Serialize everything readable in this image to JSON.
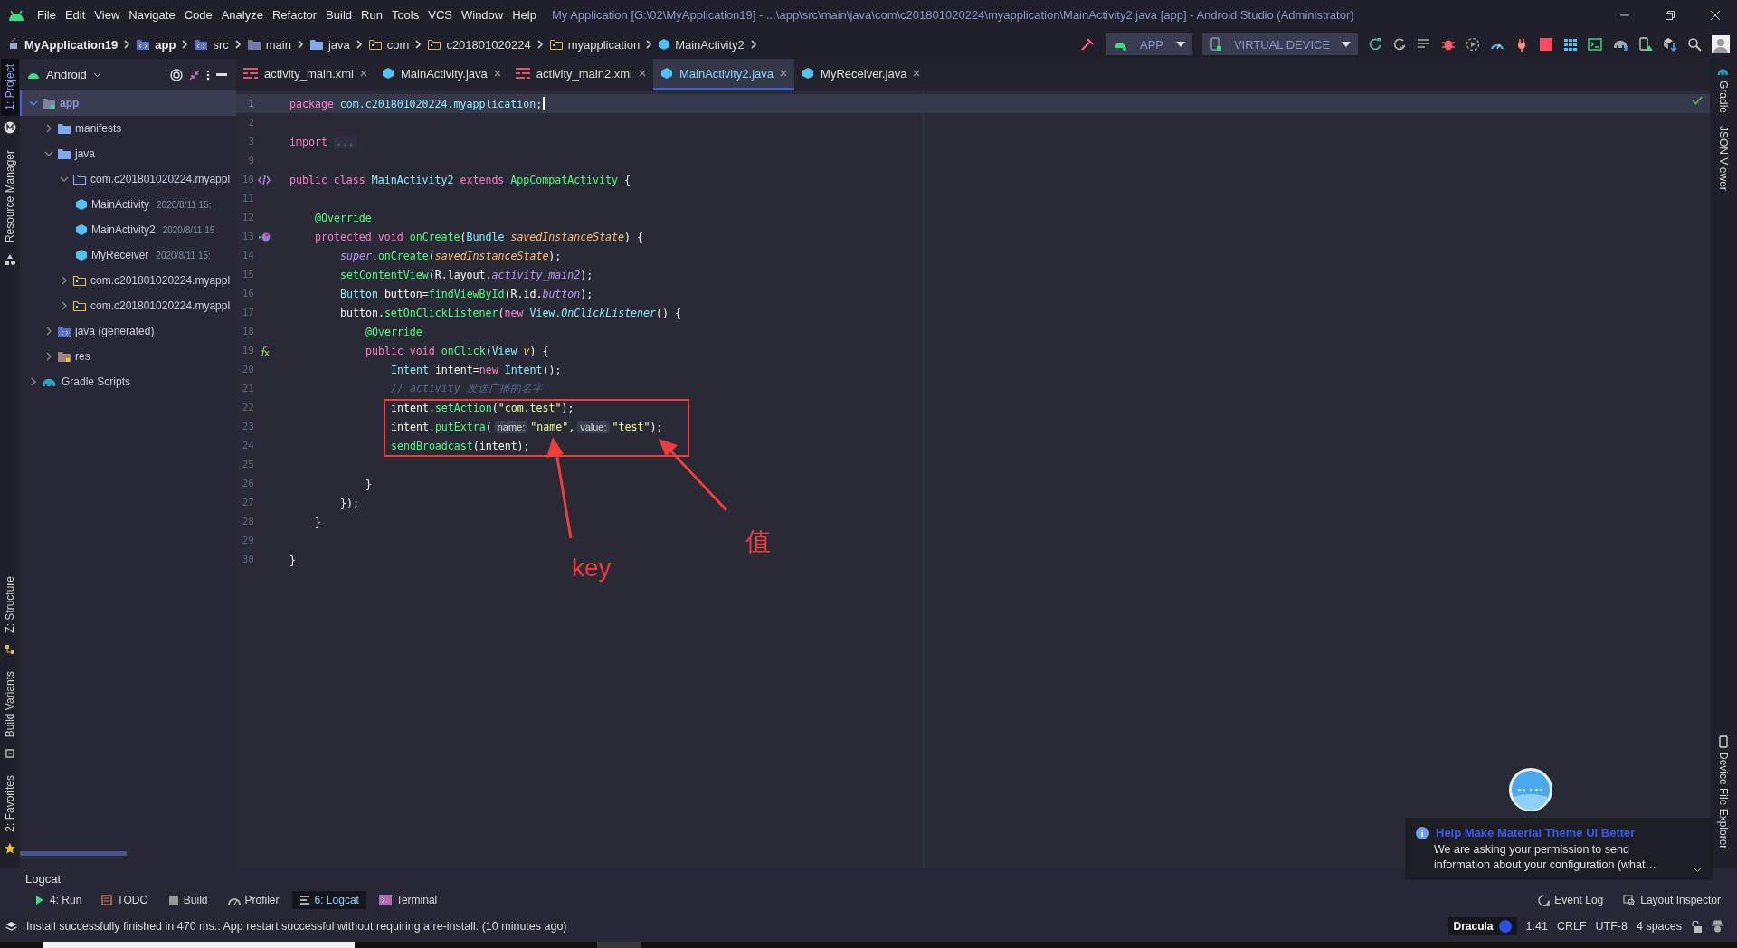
{
  "window": {
    "title": "My Application [G:\\02\\MyApplication19] - ...\\app\\src\\main\\java\\com\\c201801020224\\myapplication\\MainActivity2.java [app] - Android Studio (Administrator)"
  },
  "menu": [
    "File",
    "Edit",
    "View",
    "Navigate",
    "Code",
    "Analyze",
    "Refactor",
    "Build",
    "Run",
    "Tools",
    "VCS",
    "Window",
    "Help"
  ],
  "breadcrumb": [
    {
      "label": "MyApplication19",
      "kind": "project"
    },
    {
      "label": "app",
      "kind": "module"
    },
    {
      "label": "src",
      "kind": "source"
    },
    {
      "label": "main",
      "kind": "folder"
    },
    {
      "label": "java",
      "kind": "javafolder"
    },
    {
      "label": "com",
      "kind": "package"
    },
    {
      "label": "c201801020224",
      "kind": "package"
    },
    {
      "label": "myapplication",
      "kind": "package"
    },
    {
      "label": "MainActivity2",
      "kind": "class"
    }
  ],
  "toolbar": {
    "run_config": "APP",
    "device": "VIRTUAL DEVICE"
  },
  "left_tools_top": [
    {
      "label": "1: Project",
      "selected": true
    },
    {
      "label": "Resource Manager",
      "selected": false
    }
  ],
  "left_tools_bottom": [
    {
      "label": "Z: Structure",
      "selected": false
    },
    {
      "label": "Build Variants",
      "selected": false
    },
    {
      "label": "2: Favorites",
      "selected": false
    }
  ],
  "right_tools_top": [
    "Gradle",
    "JSON Viewer"
  ],
  "right_tools_bottom": [
    "Device File Explorer"
  ],
  "project_panel": {
    "view": "Android",
    "tree": [
      {
        "label": "app",
        "kind": "module",
        "expanded": true,
        "selected": true,
        "children": [
          {
            "label": "manifests",
            "kind": "folder",
            "expanded": false,
            "selected": false
          },
          {
            "label": "java",
            "kind": "folder",
            "expanded": true,
            "selected": false,
            "children": [
              {
                "label": "com.c201801020224.myappl",
                "kind": "package",
                "expanded": true,
                "selected": false,
                "children": [
                  {
                    "label": "MainActivity",
                    "kind": "class",
                    "date": "2020/8/11 15:",
                    "selected": false
                  },
                  {
                    "label": "MainActivity2",
                    "kind": "class",
                    "date": "2020/8/11 15",
                    "selected": false
                  },
                  {
                    "label": "MyReceiver",
                    "kind": "class",
                    "date": "2020/8/11 15:",
                    "selected": false
                  }
                ]
              },
              {
                "label": "com.c201801020224.myappl",
                "kind": "test_package",
                "expanded": false,
                "selected": false
              },
              {
                "label": "com.c201801020224.myappl",
                "kind": "test_package",
                "expanded": false,
                "selected": false
              }
            ]
          },
          {
            "label": "java (generated)",
            "kind": "generated",
            "expanded": false,
            "selected": false
          },
          {
            "label": "res",
            "kind": "res",
            "expanded": false,
            "selected": false
          }
        ]
      },
      {
        "label": "Gradle Scripts",
        "kind": "gradle",
        "expanded": false,
        "selected": false
      }
    ]
  },
  "tabs": [
    {
      "label": "activity_main.xml",
      "kind": "xml",
      "selected": false
    },
    {
      "label": "MainActivity.java",
      "kind": "class",
      "selected": false
    },
    {
      "label": "activity_main2.xml",
      "kind": "xml",
      "selected": false
    },
    {
      "label": "MainActivity2.java",
      "kind": "class",
      "selected": true
    },
    {
      "label": "MyReceiver.java",
      "kind": "class",
      "selected": false
    }
  ],
  "editor": {
    "lines": [
      {
        "number": "1",
        "current": true,
        "tokens": [
          {
            "kind": "keyword",
            "text": "package "
          },
          {
            "kind": "type",
            "text": "com.c201801020224.myapplication"
          },
          {
            "kind": "plain",
            "text": ";"
          }
        ]
      },
      {
        "number": "2",
        "current": false
      },
      {
        "number": "3",
        "current": false,
        "tokens": [
          {
            "kind": "keyword",
            "text": "import "
          },
          {
            "kind": "fold",
            "text": "..."
          }
        ]
      },
      {
        "number": "9",
        "current": false
      },
      {
        "number": "10",
        "current": false,
        "kind": "class",
        "tokens": [
          {
            "kind": "keyword",
            "text": "public class "
          },
          {
            "kind": "type",
            "text": "MainActivity2 "
          },
          {
            "kind": "keyword",
            "text": "extends "
          },
          {
            "kind": "function",
            "text": "AppCompatActivity "
          },
          {
            "kind": "plain",
            "text": "{"
          }
        ]
      },
      {
        "number": "11",
        "current": false
      },
      {
        "number": "12",
        "current": false,
        "tokens": [
          {
            "kind": "annotation",
            "text": "    @Override"
          }
        ]
      },
      {
        "number": "13",
        "current": false,
        "kind": "override",
        "tokens": [
          {
            "kind": "keyword",
            "text": "    protected void "
          },
          {
            "kind": "function",
            "text": "onCreate"
          },
          {
            "kind": "plain",
            "text": "("
          },
          {
            "kind": "type",
            "text": "Bundle "
          },
          {
            "kind": "param",
            "text": "savedInstanceState"
          },
          {
            "kind": "plain",
            "text": ") {"
          }
        ]
      },
      {
        "number": "14",
        "current": false,
        "tokens": [
          {
            "kind": "field",
            "text": "        super"
          },
          {
            "kind": "plain",
            "text": "."
          },
          {
            "kind": "function",
            "text": "onCreate"
          },
          {
            "kind": "plain",
            "text": "("
          },
          {
            "kind": "param",
            "text": "savedInstanceState"
          },
          {
            "kind": "plain",
            "text": ");"
          }
        ]
      },
      {
        "number": "15",
        "current": false,
        "tokens": [
          {
            "kind": "function",
            "text": "        setContentView"
          },
          {
            "kind": "plain",
            "text": "(R.layout."
          },
          {
            "kind": "field",
            "text": "activity_main2"
          },
          {
            "kind": "plain",
            "text": ");"
          }
        ]
      },
      {
        "number": "16",
        "current": false,
        "tokens": [
          {
            "kind": "type",
            "text": "        Button "
          },
          {
            "kind": "plain",
            "text": "button="
          },
          {
            "kind": "function",
            "text": "findViewById"
          },
          {
            "kind": "plain",
            "text": "(R.id."
          },
          {
            "kind": "field",
            "text": "button"
          },
          {
            "kind": "plain",
            "text": ");"
          }
        ]
      },
      {
        "number": "17",
        "current": false,
        "tokens": [
          {
            "kind": "plain",
            "text": "        button."
          },
          {
            "kind": "function",
            "text": "setOnClickListener"
          },
          {
            "kind": "plain",
            "text": "("
          },
          {
            "kind": "keyword",
            "text": "new "
          },
          {
            "kind": "type",
            "text": "View."
          },
          {
            "kind": "type_italic",
            "text": "OnClickListener"
          },
          {
            "kind": "plain",
            "text": "() {"
          }
        ]
      },
      {
        "number": "18",
        "current": false,
        "tokens": [
          {
            "kind": "annotation",
            "text": "            @Override"
          }
        ]
      },
      {
        "number": "19",
        "current": false,
        "kind": "lambda",
        "tokens": [
          {
            "kind": "keyword",
            "text": "            public void "
          },
          {
            "kind": "function",
            "text": "onClick"
          },
          {
            "kind": "plain",
            "text": "("
          },
          {
            "kind": "type",
            "text": "View "
          },
          {
            "kind": "param",
            "text": "v"
          },
          {
            "kind": "plain",
            "text": ") {"
          }
        ]
      },
      {
        "number": "20",
        "current": false,
        "tokens": [
          {
            "kind": "type",
            "text": "                Intent "
          },
          {
            "kind": "plain",
            "text": "intent="
          },
          {
            "kind": "keyword",
            "text": "new "
          },
          {
            "kind": "type",
            "text": "Intent"
          },
          {
            "kind": "plain",
            "text": "();"
          }
        ]
      },
      {
        "number": "21",
        "current": false,
        "tokens": [
          {
            "kind": "comment",
            "text": "                // activity 发送广播的名字"
          }
        ]
      },
      {
        "number": "22",
        "current": false,
        "tokens": [
          {
            "kind": "plain",
            "text": "                intent."
          },
          {
            "kind": "function",
            "text": "setAction"
          },
          {
            "kind": "plain",
            "text": "("
          },
          {
            "kind": "string",
            "text": "\"com.test\""
          },
          {
            "kind": "plain",
            "text": ");"
          }
        ]
      },
      {
        "number": "23",
        "current": false,
        "tokens": [
          {
            "kind": "plain",
            "text": "                intent."
          },
          {
            "kind": "function",
            "text": "putExtra"
          },
          {
            "kind": "plain",
            "text": "("
          },
          {
            "kind": "hint",
            "text": "name:"
          },
          {
            "kind": "string",
            "text": "\"name\""
          },
          {
            "kind": "plain",
            "text": ","
          },
          {
            "kind": "hint",
            "text": "value:"
          },
          {
            "kind": "string",
            "text": "\"test\""
          },
          {
            "kind": "plain",
            "text": ");"
          }
        ]
      },
      {
        "number": "24",
        "current": false,
        "tokens": [
          {
            "kind": "function",
            "text": "                sendBroadcast"
          },
          {
            "kind": "plain",
            "text": "(intent);"
          }
        ]
      },
      {
        "number": "25",
        "current": false
      },
      {
        "number": "26",
        "current": false,
        "tokens": [
          {
            "kind": "plain",
            "text": "            }"
          }
        ]
      },
      {
        "number": "27",
        "current": false,
        "tokens": [
          {
            "kind": "plain",
            "text": "        });"
          }
        ]
      },
      {
        "number": "28",
        "current": false,
        "tokens": [
          {
            "kind": "plain",
            "text": "    }"
          }
        ]
      },
      {
        "number": "29",
        "current": false
      },
      {
        "number": "30",
        "current": false,
        "tokens": [
          {
            "kind": "plain",
            "text": "}"
          }
        ]
      }
    ]
  },
  "annotations": [
    {
      "text": "key"
    },
    {
      "text": "值"
    }
  ],
  "notification": {
    "title": "Help Make Material Theme UI Better",
    "body": "We are asking your permission to send information about your configuration (what…"
  },
  "tool_window_title": "Logcat",
  "tool_tabs": [
    {
      "label": "4: Run",
      "kind": "run",
      "selected": false
    },
    {
      "label": "TODO",
      "kind": "todo",
      "selected": false
    },
    {
      "label": "Build",
      "kind": "build",
      "selected": false
    },
    {
      "label": "Profiler",
      "kind": "profiler",
      "selected": false
    },
    {
      "label": "6: Logcat",
      "kind": "logcat",
      "selected": true
    },
    {
      "label": "Terminal",
      "kind": "terminal",
      "selected": false
    }
  ],
  "status_tools": [
    {
      "label": "Event Log",
      "kind": "eventlog"
    },
    {
      "label": "Layout Inspector",
      "kind": "inspector"
    }
  ],
  "status_message": "Install successfully finished in 470 ms.: App restart successful without requiring a re-install. (10 minutes ago)",
  "status_right": {
    "theme": "Dracula",
    "position": "1:41",
    "line_separator": "CRLF",
    "encoding": "UTF-8",
    "indent": "4 spaces"
  }
}
